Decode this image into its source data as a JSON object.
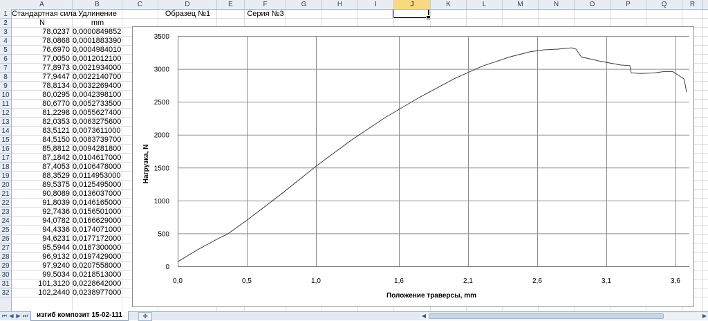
{
  "columns": [
    "A",
    "B",
    "C",
    "D",
    "E",
    "F",
    "G",
    "H",
    "I",
    "J",
    "K",
    "L",
    "M",
    "N",
    "O",
    "P",
    "Q",
    "R"
  ],
  "selected_column": "J",
  "row_numbers": [
    1,
    2,
    3,
    4,
    5,
    6,
    7,
    8,
    9,
    10,
    11,
    12,
    13,
    14,
    15,
    16,
    17,
    18,
    19,
    20,
    21,
    22,
    23,
    24,
    25,
    26,
    27,
    28,
    29,
    30,
    31,
    32
  ],
  "sheet": {
    "a1": "Стандартная сила",
    "b1": "Удлинение",
    "d1": "Образец №1",
    "f1": "Серия №3",
    "a2": "N",
    "b2": "mm",
    "rows": [
      [
        "78,0237",
        "0,0000849852"
      ],
      [
        "78,0868",
        "0,0001883390"
      ],
      [
        "76,6970",
        "0,0004984010"
      ],
      [
        "77,0050",
        "0,0012012100"
      ],
      [
        "77,8973",
        "0,0021934000"
      ],
      [
        "77,9447",
        "0,0022140700"
      ],
      [
        "78,8134",
        "0,0032269400"
      ],
      [
        "80,0295",
        "0,0042398100"
      ],
      [
        "80,6770",
        "0,0052733500"
      ],
      [
        "81,2298",
        "0,0055627400"
      ],
      [
        "82,0353",
        "0,0063275600"
      ],
      [
        "83,5121",
        "0,0073611000"
      ],
      [
        "84,5150",
        "0,0083739700"
      ],
      [
        "85,8812",
        "0,0094281800"
      ],
      [
        "87,1842",
        "0,0104617000"
      ],
      [
        "87,4053",
        "0,0106478000"
      ],
      [
        "88,3529",
        "0,0114953000"
      ],
      [
        "89,5375",
        "0,0125495000"
      ],
      [
        "90,8089",
        "0,0136037000"
      ],
      [
        "91,8039",
        "0,0146165000"
      ],
      [
        "92,7436",
        "0,0156501000"
      ],
      [
        "94,0782",
        "0,0166629000"
      ],
      [
        "94,4336",
        "0,0174071000"
      ],
      [
        "94,6231",
        "0,0177172000"
      ],
      [
        "95,5944",
        "0,0187300000"
      ],
      [
        "96,9132",
        "0,0197429000"
      ],
      [
        "97,9240",
        "0,0207558000"
      ],
      [
        "99,5034",
        "0,0218513000"
      ],
      [
        "101,3120",
        "0,0228642000"
      ],
      [
        "102,2440",
        "0,0238977000"
      ]
    ]
  },
  "chart_data": {
    "type": "line",
    "xlabel": "Положение траверсы, mm",
    "ylabel": "Нагрузка, N",
    "xlim": [
      0,
      3.7
    ],
    "ylim": [
      0,
      3500
    ],
    "x_ticks": [
      0,
      0.5,
      1.0,
      1.6,
      2.1,
      2.6,
      3.1,
      3.6
    ],
    "x_tick_labels": [
      "0,0",
      "0,5",
      "1,0",
      "1,6",
      "2,1",
      "2,6",
      "3,1",
      "3,6"
    ],
    "y_ticks": [
      0,
      500,
      1000,
      1500,
      2000,
      2500,
      3000,
      3500
    ],
    "y_tick_labels": [
      "0",
      "500",
      "1000",
      "1500",
      "2000",
      "2500",
      "3000",
      "3500"
    ],
    "grid": true,
    "series": [
      {
        "x": [
          0.0,
          0.15,
          0.3,
          0.36,
          0.5,
          0.75,
          1.0,
          1.25,
          1.5,
          1.75,
          2.0,
          2.2,
          2.4,
          2.55,
          2.65,
          2.75,
          2.85,
          2.88,
          2.92,
          3.05,
          3.2,
          3.27,
          3.28,
          3.35,
          3.45,
          3.52,
          3.58,
          3.63,
          3.66,
          3.67,
          3.68
        ],
        "y": [
          70,
          260,
          430,
          490,
          700,
          1100,
          1520,
          1910,
          2260,
          2570,
          2850,
          3040,
          3180,
          3260,
          3290,
          3300,
          3320,
          3300,
          3180,
          3120,
          3060,
          3050,
          2940,
          2930,
          2940,
          2960,
          2960,
          2890,
          2850,
          2760,
          2650
        ]
      }
    ]
  },
  "sheet_tab": {
    "label": "изгиб композит 15-02-111"
  },
  "nav_icons": [
    "first-sheet-icon",
    "prev-sheet-icon",
    "next-sheet-icon",
    "last-sheet-icon"
  ]
}
